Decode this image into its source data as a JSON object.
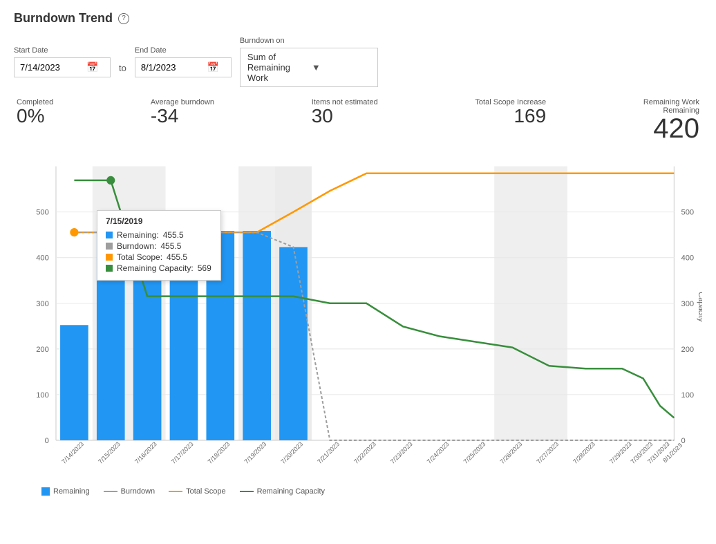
{
  "header": {
    "title": "Burndown Trend",
    "help_label": "?"
  },
  "controls": {
    "start_date_label": "Start Date",
    "start_date_value": "7/14/2023",
    "to_label": "to",
    "end_date_label": "End Date",
    "end_date_value": "8/1/2023",
    "burndown_label": "Burndown on",
    "burndown_value": "Sum of Remaining Work"
  },
  "stats": {
    "completed_label": "Completed",
    "completed_value": "0%",
    "avg_burndown_label": "Average burndown",
    "avg_burndown_value": "-34",
    "items_not_estimated_label": "Items not estimated",
    "items_not_estimated_value": "30",
    "total_scope_label": "Total Scope Increase",
    "total_scope_value": "169",
    "remaining_work_label": "Remaining Work",
    "remaining_sub_label": "Remaining",
    "remaining_value": "420"
  },
  "legend": {
    "remaining_label": "Remaining",
    "burndown_label": "Burndown",
    "total_scope_label": "Total Scope",
    "remaining_capacity_label": "Remaining Capacity"
  },
  "tooltip": {
    "date": "7/15/2019",
    "remaining_label": "Remaining:",
    "remaining_value": "455.5",
    "burndown_label": "Burndown:",
    "burndown_value": "455.5",
    "total_scope_label": "Total Scope:",
    "total_scope_value": "455.5",
    "remaining_capacity_label": "Remaining Capacity:",
    "remaining_capacity_value": "569"
  },
  "colors": {
    "remaining_bar": "#2196F3",
    "burndown_line": "#9E9E9E",
    "total_scope_line": "#FF9800",
    "remaining_capacity_line": "#388E3C",
    "weekend_bg": "#E0E0E0",
    "axis_line": "#ccc"
  }
}
